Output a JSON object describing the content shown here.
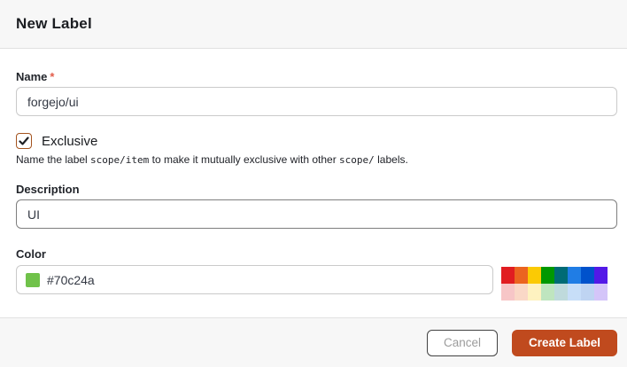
{
  "header": {
    "title": "New Label"
  },
  "form": {
    "name": {
      "label": "Name",
      "required_mark": "*",
      "value": "forgejo/ui"
    },
    "exclusive": {
      "label": "Exclusive",
      "checked": true,
      "help_segments": [
        {
          "text": "Name the label ",
          "mono": false
        },
        {
          "text": "scope/item",
          "mono": true
        },
        {
          "text": " to make it mutually exclusive with other ",
          "mono": false
        },
        {
          "text": "scope/",
          "mono": true
        },
        {
          "text": " labels.",
          "mono": false
        }
      ]
    },
    "description": {
      "label": "Description",
      "value": "UI"
    },
    "color": {
      "label": "Color",
      "value": "#70c24a",
      "swatch_color": "#70c24a",
      "palette": [
        [
          "#e11d21",
          "#eb6420",
          "#fbca04",
          "#009800",
          "#006b75",
          "#207de5",
          "#0052cc",
          "#5319e7"
        ],
        [
          "#f7c6c7",
          "#fad8c7",
          "#fef2c0",
          "#bfe5bf",
          "#bfdadc",
          "#c7def8",
          "#bfd4f2",
          "#d4c5f9"
        ]
      ]
    }
  },
  "footer": {
    "cancel_label": "Cancel",
    "create_label": "Create Label"
  },
  "colors": {
    "accent_button": "#c04a1e",
    "checkbox_border": "#a4531e",
    "required_mark": "#e25c4a",
    "header_footer_bg": "#f7f7f7"
  }
}
